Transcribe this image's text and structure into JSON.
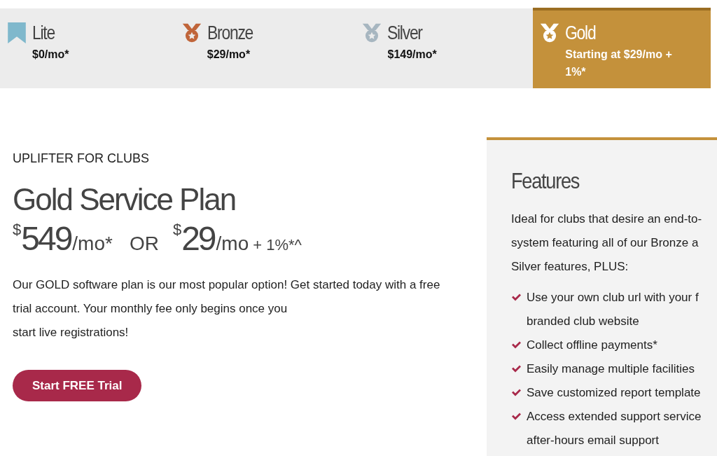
{
  "plan_tabs": [
    {
      "kind": "bookmark",
      "name": "Lite",
      "price": "$0/mo*",
      "selected": false
    },
    {
      "kind": "bronze",
      "name": "Bronze",
      "price": "$29/mo*",
      "selected": false
    },
    {
      "kind": "silver",
      "name": "Silver",
      "price": "$149/mo*",
      "selected": false
    },
    {
      "kind": "gold",
      "name": "Gold",
      "price": "Starting at $29/mo + 1%*",
      "selected": true
    }
  ],
  "plan": {
    "eyebrow": "UPLIFTER FOR CLUBS",
    "title": "Gold Service Plan",
    "price_parts": [
      {
        "kind": "big",
        "currency": "$",
        "amount": "549",
        "suffix": "/mo*"
      },
      {
        "kind": "or",
        "text": "OR"
      },
      {
        "kind": "big",
        "currency": "$",
        "amount": "29",
        "suffix": "/mo",
        "extra": "+ 1%*^"
      }
    ],
    "description": "Our GOLD software plan is our most popular option! Get started today with a free trial account. Your monthly fee only begins once you\nstart live registrations!",
    "cta": "Start FREE Trial"
  },
  "features": {
    "title": "Features",
    "intro": "Ideal for clubs that desire an end-to-\nsystem featuring all of our Bronze a\nSilver features, PLUS:",
    "items": [
      "Use your own club url with your f\nbranded club website",
      "Collect offline payments*",
      "Easily manage multiple facilities",
      "Save customized report template",
      "Access extended support service\nafter-hours email support"
    ]
  }
}
